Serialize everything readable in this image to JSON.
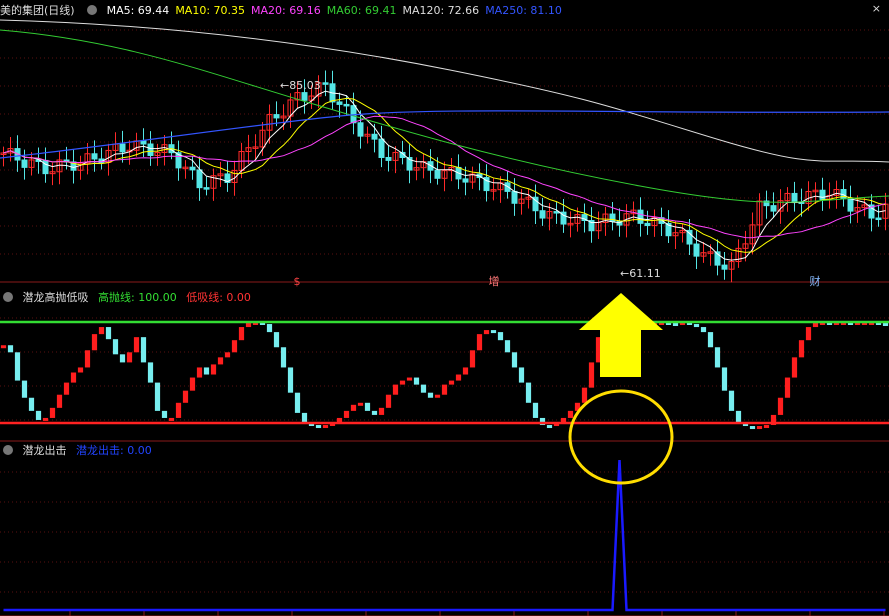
{
  "panel1": {
    "title": "美的集团(日线)",
    "ma": [
      {
        "label": "MA5: 69.44",
        "color": "#ffffff"
      },
      {
        "label": "MA10: 70.35",
        "color": "#ffff00"
      },
      {
        "label": "MA20: 69.16",
        "color": "#ff44ff"
      },
      {
        "label": "MA60: 69.41",
        "color": "#33cc33"
      },
      {
        "label": "MA120: 72.66",
        "color": "#dddddd"
      },
      {
        "label": "MA250: 81.10",
        "color": "#3355ff"
      }
    ],
    "high_label": "85.03",
    "low_label": "61.11",
    "markers": [
      {
        "text": "$",
        "color": "#ff4444"
      },
      {
        "text": "增",
        "color": "#ff7777"
      },
      {
        "text": "财",
        "color": "#88bbff"
      }
    ],
    "close_icon_label": "×"
  },
  "panel2": {
    "title": "潜龙高抛低吸",
    "line_high_label": "高抛线: 100.00",
    "line_low_label": "低吸线: 0.00",
    "line_high_color": "#33dd33",
    "line_low_color": "#ff2222"
  },
  "panel3": {
    "title": "潜龙出击",
    "value_label": "潜龙出击: 0.00",
    "line_color": "#1a1aff"
  },
  "overlays": {
    "arrow_color": "#ffff00",
    "circle_color": "#ffdd00"
  },
  "chart_data": {
    "type": "line",
    "title": "美的集团(日线)",
    "price_range": [
      61.11,
      85.03
    ],
    "n_bars": 127,
    "series": [
      {
        "name": "潜龙高抛低吸",
        "values": [
          77,
          70,
          42,
          25,
          12,
          3,
          5,
          15,
          28,
          40,
          50,
          55,
          72,
          88,
          95,
          83,
          68,
          60,
          70,
          85,
          60,
          40,
          12,
          5,
          5,
          20,
          32,
          45,
          55,
          48,
          58,
          65,
          70,
          82,
          95,
          100,
          100,
          98,
          90,
          75,
          55,
          30,
          10,
          0,
          -2,
          -3,
          -2,
          0,
          5,
          12,
          18,
          20,
          12,
          8,
          15,
          28,
          38,
          42,
          45,
          38,
          30,
          25,
          28,
          38,
          42,
          48,
          55,
          72,
          88,
          92,
          90,
          82,
          70,
          55,
          40,
          20,
          5,
          -2,
          -3,
          0,
          5,
          12,
          20,
          35,
          60,
          85,
          98,
          100,
          100,
          100,
          100,
          99,
          98,
          100,
          100,
          99,
          97,
          100,
          98,
          95,
          90,
          75,
          55,
          32,
          12,
          0,
          -3,
          -4,
          -3,
          -2,
          8,
          25,
          45,
          65,
          82,
          95,
          100,
          100,
          99,
          100,
          100,
          98,
          100,
          100,
          100,
          99,
          98
        ]
      },
      {
        "name": "潜龙出击",
        "values": [
          0,
          0,
          0,
          0,
          0,
          0,
          0,
          0,
          0,
          0,
          0,
          0,
          0,
          0,
          0,
          0,
          0,
          0,
          0,
          0,
          0,
          0,
          0,
          0,
          0,
          0,
          0,
          0,
          0,
          0,
          0,
          0,
          0,
          0,
          0,
          0,
          0,
          0,
          0,
          0,
          0,
          0,
          0,
          0,
          0,
          0,
          0,
          0,
          0,
          0,
          0,
          0,
          0,
          0,
          0,
          0,
          0,
          0,
          0,
          0,
          0,
          0,
          0,
          0,
          0,
          0,
          0,
          0,
          0,
          0,
          0,
          0,
          0,
          0,
          0,
          0,
          0,
          0,
          0,
          0,
          0,
          0,
          0,
          0,
          0,
          0,
          0,
          0,
          1,
          0,
          0,
          0,
          0,
          0,
          0,
          0,
          0,
          0,
          0,
          0,
          0,
          0,
          0,
          0,
          0,
          0,
          0,
          0,
          0,
          0,
          0,
          0,
          0,
          0,
          0,
          0,
          0,
          0,
          0,
          0,
          0,
          0,
          0,
          0,
          0,
          0,
          0
        ]
      }
    ]
  }
}
